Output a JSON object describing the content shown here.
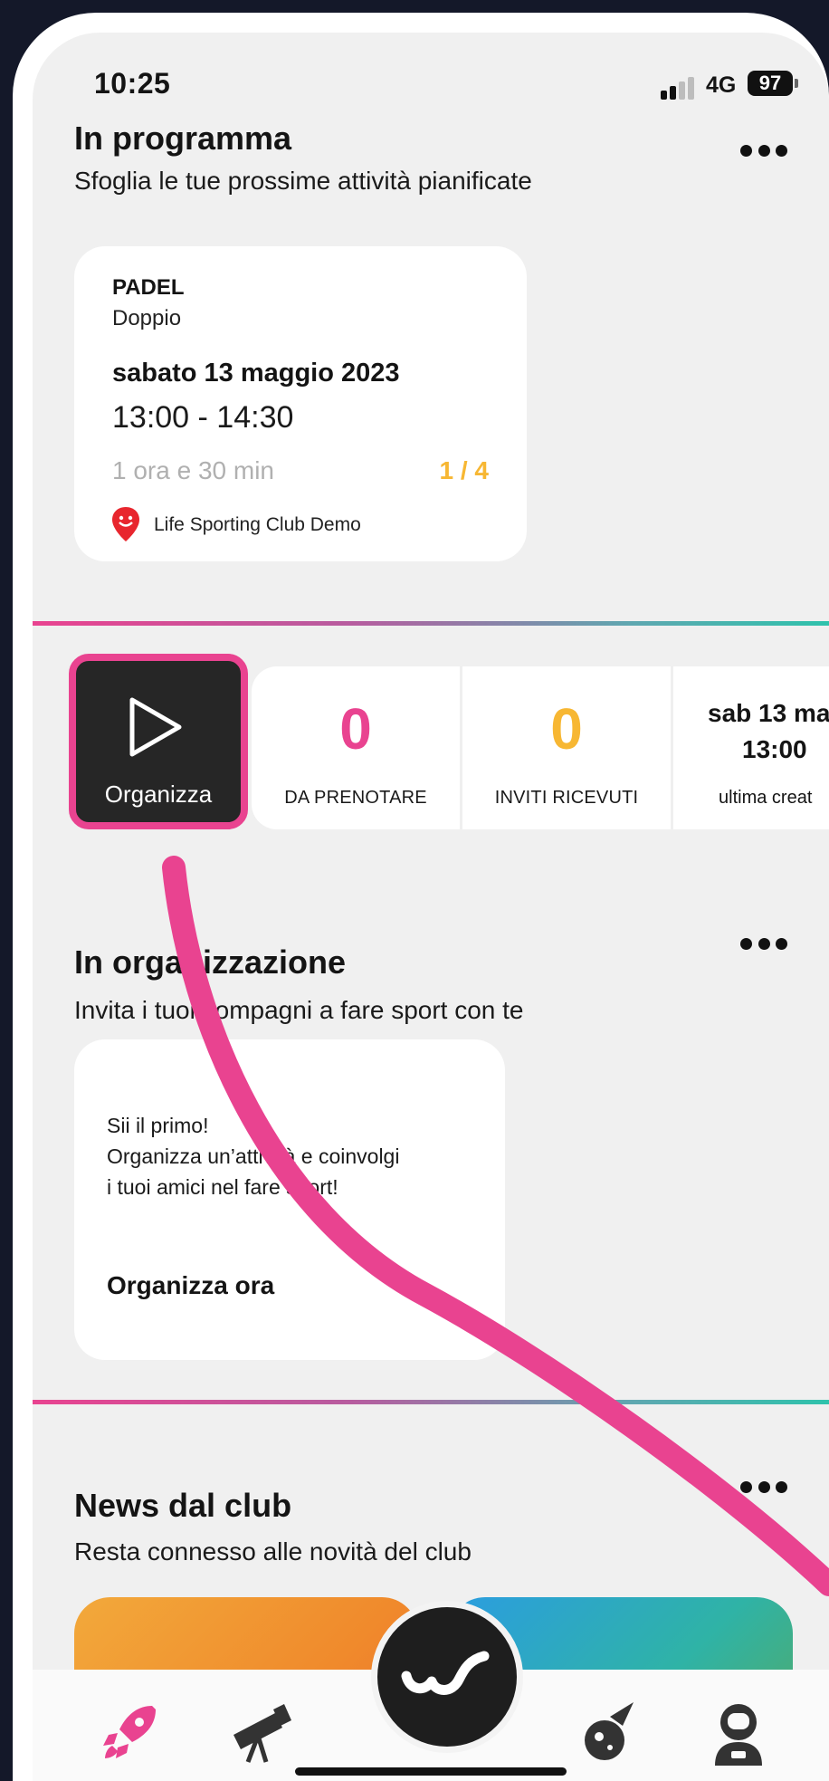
{
  "status": {
    "time": "10:25",
    "network": "4G",
    "battery": "97"
  },
  "scheduled": {
    "title": "In programma",
    "subtitle": "Sfoglia le tue prossime attività pianificate",
    "card": {
      "sport": "PADEL",
      "type": "Doppio",
      "date": "sabato 13 maggio 2023",
      "time": "13:00 - 14:30",
      "duration": "1 ora e 30 min",
      "players": "1 / 4",
      "club": "Life Sporting Club Demo"
    }
  },
  "quick": {
    "organize_label": "Organizza",
    "stats": [
      {
        "value": "0",
        "label": "DA PRENOTARE",
        "color": "#e94390"
      },
      {
        "value": "0",
        "label": "INVITI RICEVUTI",
        "color": "#f7b733"
      },
      {
        "value_line1": "sab 13 ma",
        "value_line2": "13:00",
        "label": "ultima creat"
      }
    ]
  },
  "organizing": {
    "title": "In organizzazione",
    "subtitle": "Invita i tuoi compagni a fare sport con te",
    "card": {
      "line1": "Sii il primo!",
      "line2": "Organizza un’attività e coinvolgi",
      "line3": "i tuoi amici nel fare sport!",
      "cta": "Organizza ora"
    }
  },
  "news": {
    "title": "News dal club",
    "subtitle": "Resta connesso alle novità del club"
  },
  "tabbar": {
    "items": [
      "rocket-icon",
      "telescope-icon",
      "fab-logo-icon",
      "comet-icon",
      "astronaut-icon"
    ]
  },
  "colors": {
    "accent": "#e94390",
    "gold": "#f7b733",
    "teal": "#2fc2ac"
  }
}
